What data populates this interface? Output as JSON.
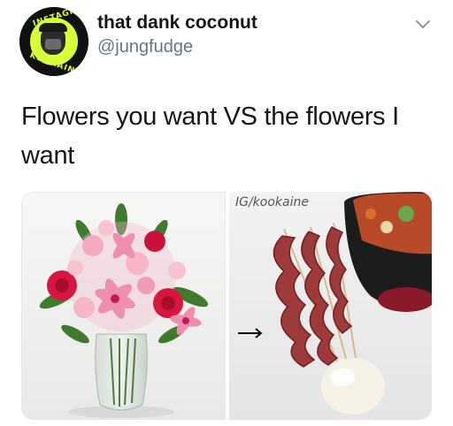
{
  "tweet": {
    "display_name": "that dank coconut",
    "handle": "@jungfudge",
    "text": "Flowers you want VS the flowers I want",
    "avatar": {
      "ring_text_top": "INSTAGRAM",
      "ring_text_bottom": "KOOKAINE",
      "accent_color": "#d7ff3b"
    },
    "menu_icon": "chevron-down-icon"
  },
  "media": {
    "left": {
      "subject": "pink lily and rose bouquet in glass vase"
    },
    "right": {
      "subject": "bacon strips on skewers",
      "watermark": "IG/kookaine"
    }
  },
  "colors": {
    "text": "#14171a",
    "secondary_text": "#657786",
    "background": "#ffffff"
  }
}
